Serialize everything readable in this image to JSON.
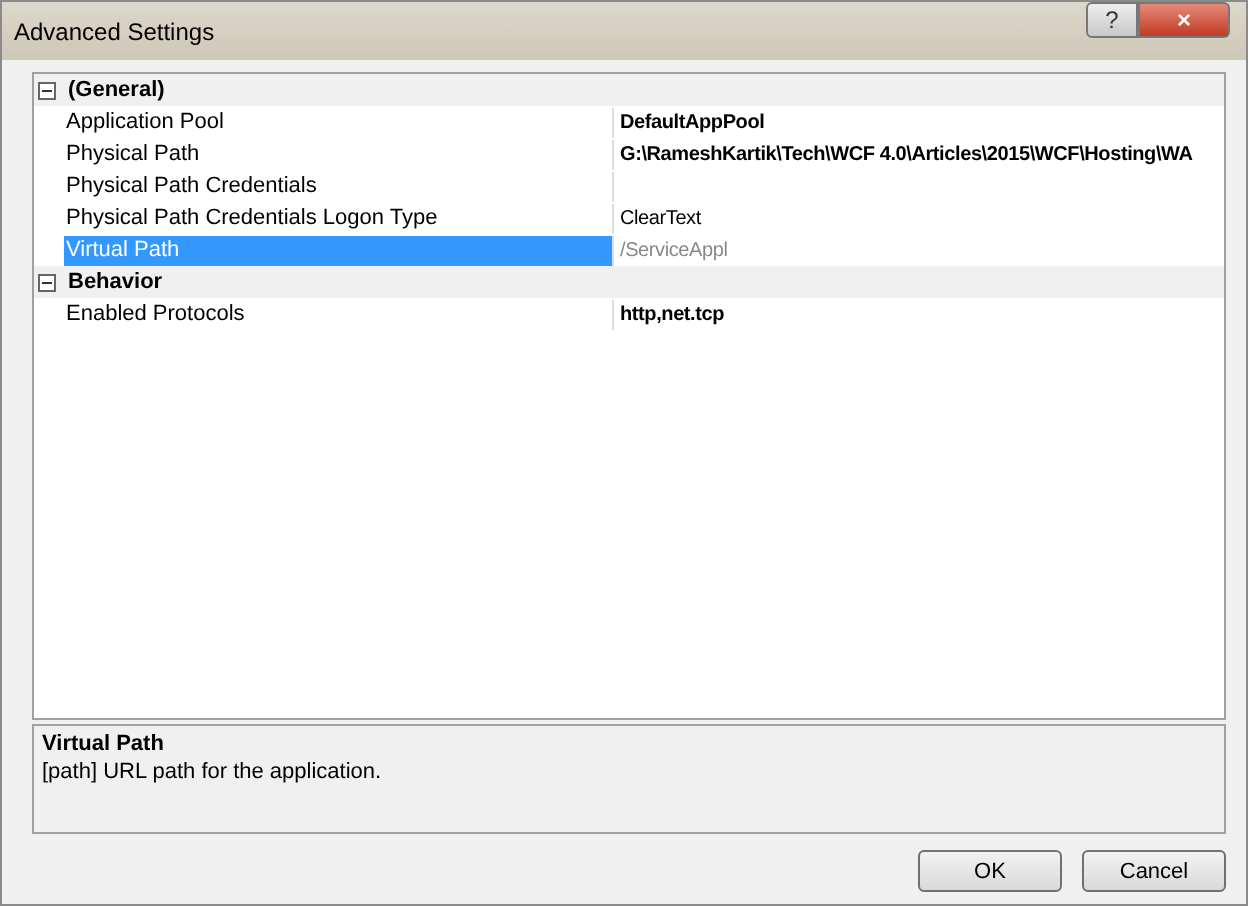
{
  "window": {
    "title": "Advanced Settings",
    "buttons": [
      "?",
      "×"
    ]
  },
  "property_grid": {
    "categories": [
      {
        "label": "(General)",
        "expanded": true,
        "properties": [
          {
            "name": "Application Pool",
            "value": "DefaultAppPool",
            "kind": "modified",
            "selected": false
          },
          {
            "name": "Physical Path",
            "value": "G:\\RameshKartik\\Tech\\WCF 4.0\\Articles\\2015\\WCF\\Hosting\\WA",
            "kind": "modified",
            "selected": false
          },
          {
            "name": "Physical Path Credentials",
            "kind": "default",
            "selected": false
          },
          {
            "name": "Physical Path Credentials Logon Type",
            "value": "ClearText",
            "kind": "default",
            "selected": false
          },
          {
            "name": "Virtual Path",
            "value": "/ServiceAppl",
            "kind": "readonly",
            "selected": true
          }
        ]
      },
      {
        "label": "Behavior",
        "expanded": true,
        "properties": [
          {
            "name": "Enabled Protocols",
            "value": "http,net.tcp",
            "kind": "modified",
            "selected": false
          }
        ]
      }
    ]
  },
  "description": {
    "title": "Virtual Path",
    "text": "[path] URL path for the application."
  },
  "buttons": [
    "OK",
    "Cancel"
  ]
}
